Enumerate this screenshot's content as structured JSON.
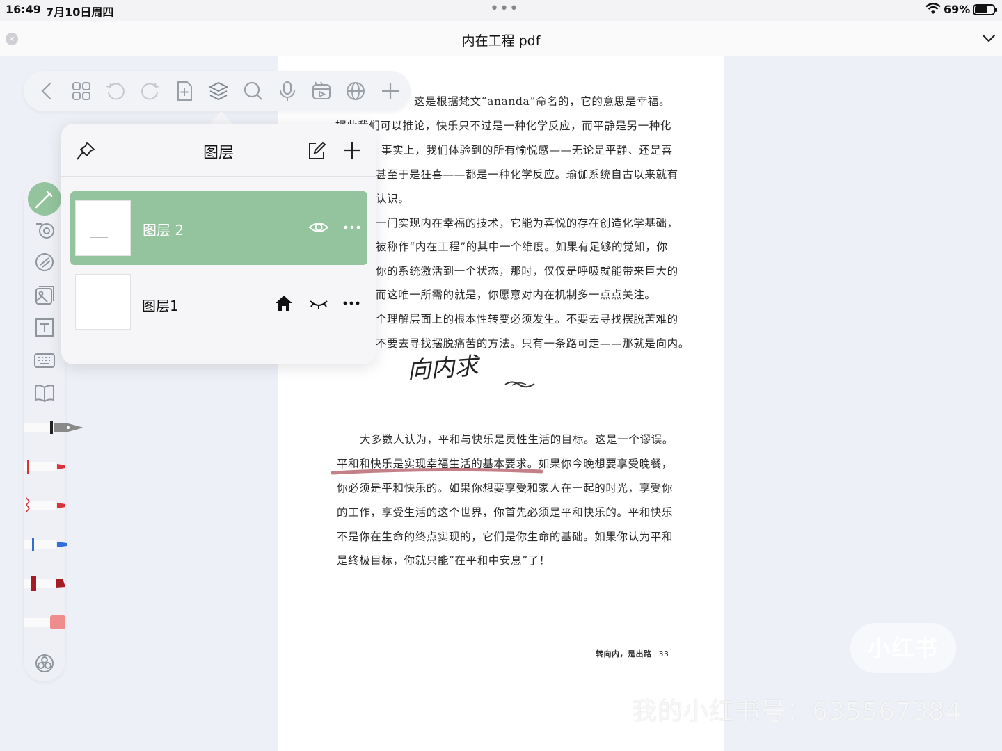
{
  "status_bar": {
    "time": "16:49",
    "date": "7月10日周四",
    "dots": "•••",
    "battery": "69%",
    "battery_level": 0.69
  },
  "title_bar": {
    "title": "内在工程 pdf",
    "close_glyph": "×"
  },
  "toolbar": {
    "icons": [
      "back-icon",
      "grid-icon",
      "undo-icon",
      "redo-icon",
      "add-page-icon",
      "layers-icon",
      "search-icon",
      "microphone-icon",
      "media-icon",
      "globe-icon",
      "plus-icon"
    ]
  },
  "layers_panel": {
    "title": "图层",
    "layers": [
      {
        "name": "图层 2",
        "selected": true,
        "visible": true
      },
      {
        "name": "图层1",
        "selected": false,
        "visible": false,
        "home": true
      }
    ]
  },
  "tool_strip": {
    "icons": [
      "pencil-icon",
      "eraser-icon",
      "lasso-icon",
      "image-icon",
      "text-box-icon",
      "keyboard-icon",
      "book-icon",
      "palette-icon"
    ],
    "tools": [
      "fountain-pen",
      "red-pen",
      "red-brush",
      "blue-pen",
      "dark-red-marker",
      "pink-highlighter"
    ],
    "colors": {
      "accent": "#93c49d",
      "red": "#d9343b",
      "blue": "#2f6fd6",
      "dark_red": "#a51c22",
      "pink": "#ef8d8d"
    }
  },
  "pdf_page": {
    "lines": [
      "这是根据梵文“ananda”命名的，它的意思是幸福。",
      "据此我们可以推论，快乐只不过是一种化学反应，而平静是另一种化",
      "事实上，我们体验到的所有愉悦感——无论是平静、还是喜",
      "甚至于是狂喜——都是一种化学反应。瑜伽系统自古以来就有",
      "认识。",
      "一门实现内在幸福的技术，它能为喜悦的存在创造化学基础，",
      "被称作“内在工程”的其中一个维度。如果有足够的觉知，你",
      "你的系统激活到一个状态，那时，仅仅是呼吸就能带来巨大的",
      "而这唯一所需的就是，你愿意对内在机制多一点点关注。",
      "个理解层面上的根本性转变必须发生。不要去寻找摆脱苦难的",
      "不要去寻找摆脱痛苦的方法。只有一条路可走——那就是向内。",
      "大多数人认为，平和与快乐是灵性生活的目标。这是一个谬误。",
      "平和和快乐是实现幸福生活的基本要求。如果你今晚想要享受晚餐，",
      "你必须是平和快乐的。如果你想要享受和家人在一起的时光，享受你",
      "的工作，享受生活的这个世界，你首先必须是平和快乐的。平和快乐",
      "不是你在生命的终点实现的，它们是你生命的基础。如果你认为平和",
      "是终极目标，你就只能“在平和中安息”了！"
    ],
    "handwriting": "向内求",
    "footer": "转向内，是出路",
    "page_number": "33"
  },
  "watermark": {
    "logo": "小红书",
    "account": "我的小红书号：635567384"
  }
}
